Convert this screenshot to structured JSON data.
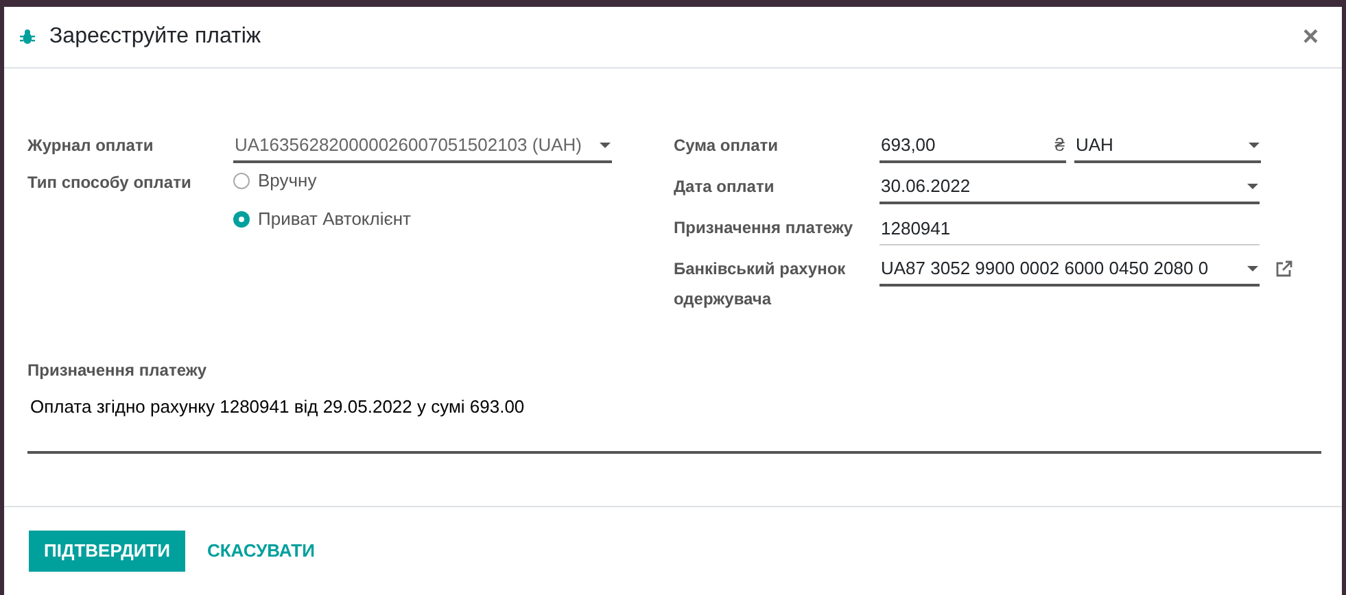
{
  "dialog": {
    "title": "Зареєструйте платіж",
    "close": "×"
  },
  "left_fields": [
    {
      "kind": "select",
      "label": "Журнал оплати",
      "value": "UA163562820000026007051502103 (UAH)",
      "disabled": true
    },
    {
      "kind": "radio",
      "label": "Тип способу оплати",
      "options": [
        {
          "label": "Вручну",
          "selected": false
        },
        {
          "label": "Приват Автоклієнт",
          "selected": true
        }
      ]
    }
  ],
  "right_fields": [
    {
      "kind": "amount",
      "label": "Сума оплати",
      "value": "693,00",
      "currency_symbol": "₴",
      "currency": "UAH"
    },
    {
      "kind": "select",
      "label": "Дата оплати",
      "value": "30.06.2022"
    },
    {
      "kind": "text",
      "label": "Призначення платежу",
      "value": "1280941"
    },
    {
      "kind": "select",
      "label": "Банківський рахунок одержувача",
      "value": "UA87 3052 9900 0002 6000 0450 2080 0",
      "external_link": true
    }
  ],
  "memo": {
    "label": "Призначення платежу",
    "value": "Оплата згідно рахунку 1280941 від 29.05.2022 у сумі 693.00"
  },
  "buttons": [
    {
      "label": "ПІДТВЕРДИТИ",
      "kind": "primary"
    },
    {
      "label": "СКАСУВАТИ",
      "kind": "link"
    }
  ]
}
